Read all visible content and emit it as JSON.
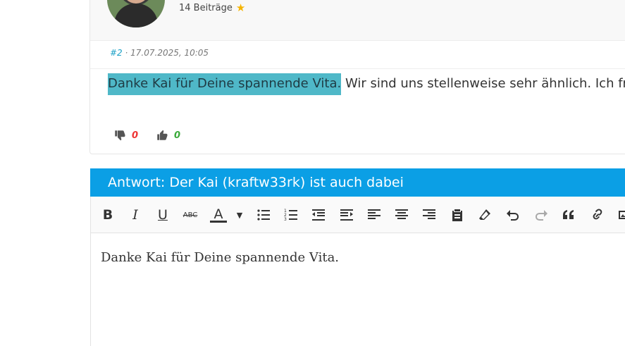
{
  "post": {
    "author_post_count": "14 Beiträge",
    "post_number": "#2",
    "post_date": " · 17.07.2025, 10:05",
    "text_highlighted": "Danke Kai für Deine spannende Vita.",
    "text_rest": " Wir sind uns stellenweise sehr ähnlich. Ich fre",
    "dislike_count": "0",
    "like_count": "0"
  },
  "reply": {
    "title": "Antwort: Der Kai (kraftw33rk) ist auch dabei",
    "editor_content": "Danke Kai für Deine spannende Vita."
  },
  "toolbar": {
    "buttons": [
      "bold",
      "italic",
      "underline",
      "strikethrough",
      "text-color",
      "color-dropdown",
      "bullet-list",
      "numbered-list",
      "outdent",
      "indent",
      "align-left",
      "align-center",
      "align-right",
      "paste",
      "eraser",
      "undo",
      "redo",
      "quote",
      "link",
      "image"
    ],
    "bold_label": "B",
    "italic_label": "I",
    "underline_label": "U",
    "strike_label": "ABC",
    "color_label": "A"
  },
  "colors": {
    "accent": "#0b9fe5",
    "highlight": "#4fb8c8",
    "dislike": "#e33333",
    "like": "#3aaa3a",
    "star": "#f5b400"
  }
}
